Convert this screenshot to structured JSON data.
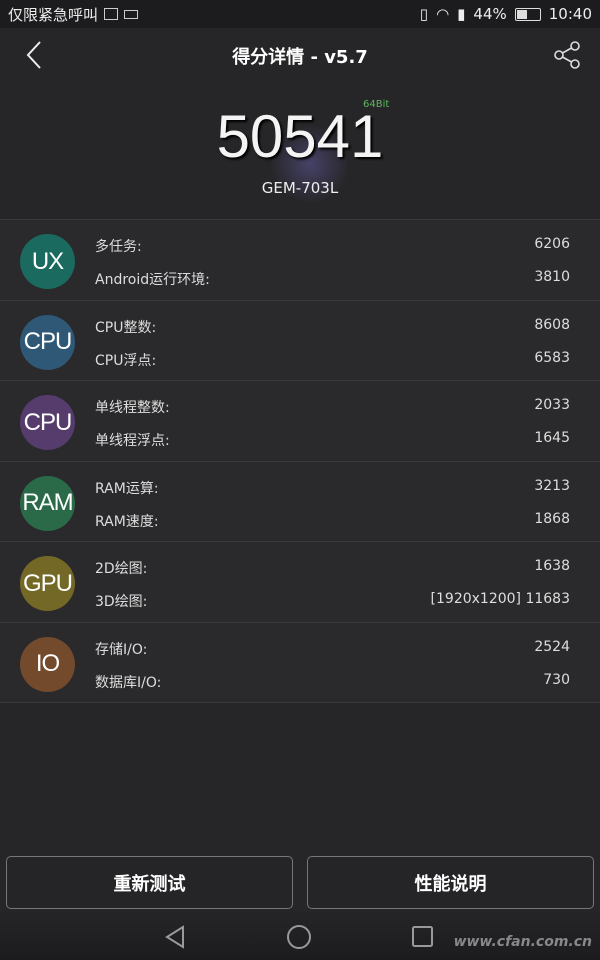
{
  "status_bar": {
    "carrier": "仅限紧急呼叫",
    "battery": "44%",
    "battery_level": 0.44,
    "time": "10:40"
  },
  "header": {
    "title": "得分详情 - v5.7"
  },
  "score": {
    "total": "50541",
    "bit": "64Bit",
    "device": "GEM-703L"
  },
  "categories": [
    {
      "badge": "UX",
      "color": "#1b6a5f",
      "items": [
        {
          "label": "多任务:",
          "value": "6206"
        },
        {
          "label": "Android运行环境:",
          "value": "3810"
        }
      ]
    },
    {
      "badge": "CPU",
      "color": "#2e5876",
      "items": [
        {
          "label": "CPU整数:",
          "value": "8608"
        },
        {
          "label": "CPU浮点:",
          "value": "6583"
        }
      ]
    },
    {
      "badge": "CPU",
      "color": "#563c6c",
      "items": [
        {
          "label": "单线程整数:",
          "value": "2033"
        },
        {
          "label": "单线程浮点:",
          "value": "1645"
        }
      ]
    },
    {
      "badge": "RAM",
      "color": "#2a6a48",
      "items": [
        {
          "label": "RAM运算:",
          "value": "3213"
        },
        {
          "label": "RAM速度:",
          "value": "1868"
        }
      ]
    },
    {
      "badge": "GPU",
      "color": "#746826",
      "items": [
        {
          "label": "2D绘图:",
          "value": "1638"
        },
        {
          "label": "3D绘图:",
          "value": "[1920x1200] 11683"
        }
      ]
    },
    {
      "badge": "IO",
      "color": "#744a2c",
      "items": [
        {
          "label": "存储I/O:",
          "value": "2524"
        },
        {
          "label": "数据库I/O:",
          "value": "730"
        }
      ]
    }
  ],
  "buttons": {
    "retest": "重新测试",
    "info": "性能说明"
  },
  "watermark": "www.cfan.com.cn"
}
